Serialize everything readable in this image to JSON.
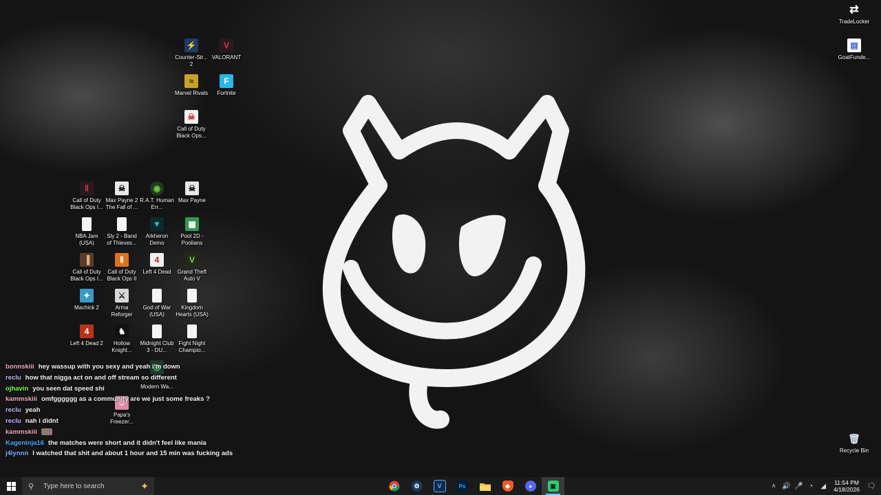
{
  "desktop": {
    "icons": [
      {
        "id": "cs2",
        "label": "Counter-Str... 2",
        "color": "#e0a020",
        "glyph": "⚡"
      },
      {
        "id": "valorant",
        "label": "VALORANT",
        "color": "#d8344a",
        "glyph": "V"
      },
      {
        "id": "marvel-rivals",
        "label": "Marvel Rivals",
        "color": "#c9a227",
        "glyph": "≈"
      },
      {
        "id": "fortnite",
        "label": "Fortnite",
        "color": "#2bb6e8",
        "glyph": "F"
      },
      {
        "id": "cod-bo-1",
        "label": "Call of Duty Black Ops...",
        "color": "#d12f2f",
        "glyph": "☠"
      },
      {
        "id": "cod-bo-2",
        "label": "Call of Duty Black Ops I...",
        "color": "#7a1d2a",
        "glyph": "Ⅱ"
      },
      {
        "id": "max-payne-2",
        "label": "Max Payne 2 The Fall of ...",
        "color": "#e8e8e8",
        "glyph": "☠"
      },
      {
        "id": "rat",
        "label": "R.A.T. Human Err...",
        "color": "#4a9a2a",
        "glyph": "◉"
      },
      {
        "id": "max-payne",
        "label": "Max Payne",
        "color": "#e8e8e8",
        "glyph": "☠"
      },
      {
        "id": "nba-jam",
        "label": "NBA Jam (USA)",
        "color": "#f4f4f4",
        "glyph": ""
      },
      {
        "id": "sly2",
        "label": "Sly 2 - Band of Thieves...",
        "color": "#f4f4f4",
        "glyph": ""
      },
      {
        "id": "arkheron",
        "label": "Arkheron Demo",
        "color": "#1e8a7a",
        "glyph": "▼"
      },
      {
        "id": "pool2d",
        "label": "Pool 2D - Poolians",
        "color": "#2e9a4a",
        "glyph": "▦"
      },
      {
        "id": "cod-bo-3",
        "label": "Call of Duty Black Ops I...",
        "color": "#8a5a3a",
        "glyph": "▐"
      },
      {
        "id": "cod-bo-ii",
        "label": "Call of Duty Black Ops II",
        "color": "#e07020",
        "glyph": "Ⅱ"
      },
      {
        "id": "l4d",
        "label": "Left 4 Dead",
        "color": "#c21f1f",
        "glyph": "4"
      },
      {
        "id": "gta5",
        "label": "Grand Theft Auto V",
        "color": "#4a8a3a",
        "glyph": "V"
      },
      {
        "id": "machick2",
        "label": "Machick 2",
        "color": "#3a9ac8",
        "glyph": "✦"
      },
      {
        "id": "arma",
        "label": "Arma Reforger",
        "color": "#d8d8d8",
        "glyph": "⚔"
      },
      {
        "id": "gow",
        "label": "God of War (USA)",
        "color": "#f4f4f4",
        "glyph": ""
      },
      {
        "id": "kh",
        "label": "Kingdom Hearts (USA)",
        "color": "#f4f4f4",
        "glyph": ""
      },
      {
        "id": "l4d2",
        "label": "Left 4 Dead 2",
        "color": "#b8321a",
        "glyph": "4"
      },
      {
        "id": "hollow",
        "label": "Hollow Knight...",
        "color": "#e8e8e8",
        "glyph": "♞"
      },
      {
        "id": "midnight",
        "label": "Midnight Club 3 - DU...",
        "color": "#f4f4f4",
        "glyph": ""
      },
      {
        "id": "fightnight",
        "label": "Fight Night Champio...",
        "color": "#f4f4f4",
        "glyph": ""
      },
      {
        "id": "modern-warfare",
        "label": "Modern Wa...",
        "color": "#3a8a5a",
        "glyph": "◎"
      },
      {
        "id": "papas",
        "label": "Papa's Freezer...",
        "color": "#e08aa8",
        "glyph": "☺"
      },
      {
        "id": "tradelocker",
        "label": "TradeLocker",
        "color": "#ffffff",
        "glyph": "⇄"
      },
      {
        "id": "goatfunded",
        "label": "GoatFunde...",
        "color": "#ffffff",
        "glyph": "▤"
      },
      {
        "id": "recycle",
        "label": "Recycle Bin",
        "color": "#d8e4f0",
        "glyph": "🗑"
      }
    ]
  },
  "chat": {
    "messages": [
      {
        "user": "bonnskiii",
        "color": "#f0a8c0",
        "text": "hey wassup with you sexy and yeah i'm down"
      },
      {
        "user": "reclu",
        "color": "#c8b2ff",
        "text": "how that nigga act on and off stream so different"
      },
      {
        "user": "ojhavin",
        "color": "#7fff4a",
        "text": "you seen dat speed shi"
      },
      {
        "user": "kammskiii",
        "color": "#f0a8c0",
        "text": "omfgggggg as a community are we just some freaks ?"
      },
      {
        "user": "reclu",
        "color": "#c8b2ff",
        "text": "yeah"
      },
      {
        "user": "reclu",
        "color": "#c8b2ff",
        "text": "nah i didnt"
      },
      {
        "user": "kammskiii",
        "color": "#f0a8c0",
        "text": ""
      },
      {
        "user": "Kageninja16",
        "color": "#4aa8ff",
        "text": "the matches were short and it didn't feel like mania"
      },
      {
        "user": "j4lynnn",
        "color": "#7ab0ff",
        "text": "I watched that shit and about 1 hour and 15 min was fucking ads"
      }
    ]
  },
  "taskbar": {
    "search_placeholder": "Type here to search",
    "apps": [
      {
        "id": "chrome",
        "glyph": "◉",
        "color": "#e8453c"
      },
      {
        "id": "steam",
        "glyph": "⚙",
        "color": "#1b3a5a"
      },
      {
        "id": "vegas",
        "glyph": "V",
        "color": "#1a3a6a"
      },
      {
        "id": "photoshop",
        "glyph": "Ps",
        "color": "#0a2a4a"
      },
      {
        "id": "file-explorer",
        "glyph": "▬",
        "color": "#f2c240"
      },
      {
        "id": "brave",
        "glyph": "◆",
        "color": "#f05a24"
      },
      {
        "id": "discord",
        "glyph": "◕",
        "color": "#5865f2"
      },
      {
        "id": "obs-green",
        "glyph": "▣",
        "color": "#2ecc71"
      }
    ],
    "clock_time": "11:54 PM",
    "clock_date": "4/18/2026"
  }
}
